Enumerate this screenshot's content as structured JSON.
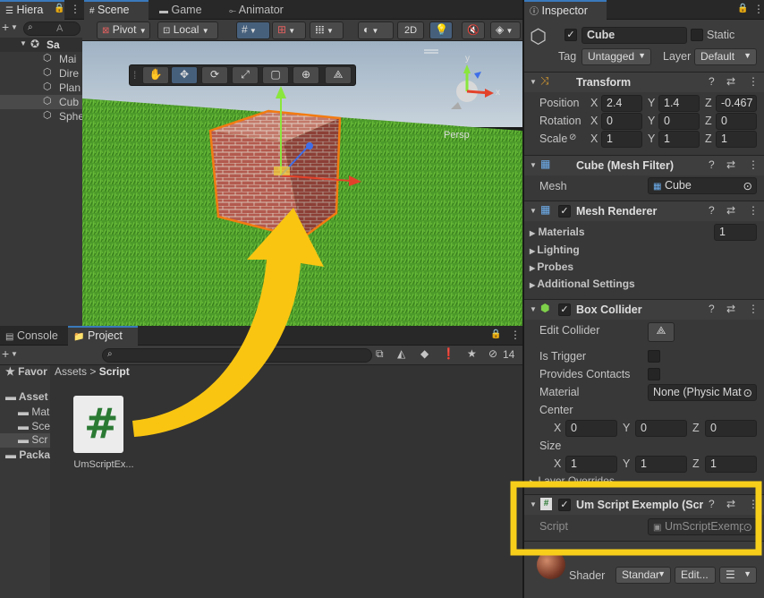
{
  "hierarchy": {
    "tab": "Hiera",
    "search_placeholder": "A",
    "scene": "Sa",
    "items": [
      "Mai",
      "Dire",
      "Plan",
      "Cub",
      "Sphe"
    ]
  },
  "scene_view": {
    "tabs": [
      "Scene",
      "Game",
      "Animator"
    ],
    "pivot": "Pivot",
    "local": "Local",
    "btn_2d": "2D",
    "persp": "Persp",
    "gizmo_labels": {
      "y": "y",
      "x": "x"
    }
  },
  "project": {
    "tabs": [
      "Console",
      "Project"
    ],
    "hidden_count": "14",
    "breadcrumb_root": "Assets",
    "breadcrumb_current": "Script",
    "tree": [
      "Favor",
      "Asset",
      "Mat",
      "Sce",
      "Scr",
      "Packa"
    ],
    "file_name": "UmScriptEx...",
    "file_glyph": "#"
  },
  "inspector": {
    "tab": "Inspector",
    "object_name": "Cube",
    "static_label": "Static",
    "tag_label": "Tag",
    "tag_value": "Untagged",
    "layer_label": "Layer",
    "layer_value": "Default",
    "transform": {
      "title": "Transform",
      "rows": [
        {
          "label": "Position",
          "x": "2.4",
          "y": "1.4",
          "z": "-0.467"
        },
        {
          "label": "Rotation",
          "x": "0",
          "y": "0",
          "z": "0"
        },
        {
          "label": "Scale",
          "x": "1",
          "y": "1",
          "z": "1"
        }
      ]
    },
    "mesh_filter": {
      "title": "Cube (Mesh Filter)",
      "mesh_label": "Mesh",
      "mesh_value": "Cube"
    },
    "mesh_renderer": {
      "title": "Mesh Renderer",
      "materials_label": "Materials",
      "materials_count": "1",
      "sections": [
        "Lighting",
        "Probes",
        "Additional Settings"
      ]
    },
    "box_collider": {
      "title": "Box Collider",
      "edit_collider": "Edit Collider",
      "is_trigger": "Is Trigger",
      "provides_contacts": "Provides Contacts",
      "material_label": "Material",
      "material_value": "None (Physic Mat",
      "center_label": "Center",
      "center": {
        "x": "0",
        "y": "0",
        "z": "0"
      },
      "size_label": "Size",
      "size": {
        "x": "1",
        "y": "1",
        "z": "1"
      },
      "layer_overrides": "Layer Overrides"
    },
    "script_comp": {
      "title": "Um Script Exemplo (Scr",
      "script_label": "Script",
      "script_value": "UmScriptExemp"
    },
    "material": {
      "shader_label": "Shader",
      "shader_value": "Standar",
      "edit": "Edit..."
    }
  },
  "colors": {
    "highlight": "#f7cf1a",
    "accent": "#3a79bb",
    "arrow": "#f9c511"
  }
}
